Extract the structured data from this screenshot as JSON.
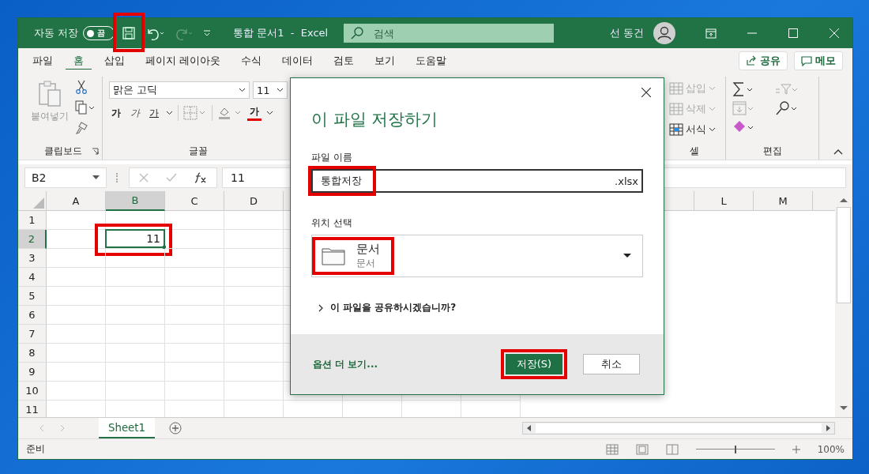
{
  "title_bar": {
    "autosave_label": "자동 저장",
    "autosave_toggle": {
      "label": "끔",
      "on": false
    },
    "save": {
      "annotated": true
    },
    "redo": {
      "disabled": true
    },
    "document_title": "통합 문서1  -  Excel",
    "search_placeholder": "검색",
    "user_name": "선 동건"
  },
  "tabs": [
    {
      "label": "파일",
      "selected": false
    },
    {
      "label": "홈",
      "selected": true
    },
    {
      "label": "삽입",
      "selected": false
    },
    {
      "label": "페이지 레이아웃",
      "selected": false
    },
    {
      "label": "수식",
      "selected": false
    },
    {
      "label": "데이터",
      "selected": false
    },
    {
      "label": "검토",
      "selected": false
    },
    {
      "label": "보기",
      "selected": false
    },
    {
      "label": "도움말",
      "selected": false
    }
  ],
  "share_button": "공유",
  "comment_button": "메모",
  "ribbon": {
    "clipboard": {
      "paste_label": "붙여넣기",
      "group_label": "클립보드"
    },
    "font": {
      "font_name": "맑은 고딕",
      "font_size": "11",
      "bold": "가",
      "italic": "가",
      "underline": "가",
      "font_color": "가",
      "group_label": "글꼴"
    },
    "cells": {
      "items": [
        {
          "label": "삽입",
          "disabled": true
        },
        {
          "label": "삭제",
          "disabled": true
        },
        {
          "label": "서식",
          "disabled": false
        }
      ],
      "group_label": "셀"
    },
    "editing": {
      "group_label": "편집"
    }
  },
  "formula_bar": {
    "name_box": "B2",
    "value": "11"
  },
  "sheet": {
    "columns": [
      {
        "label": "A",
        "selected": false
      },
      {
        "label": "B",
        "selected": true
      },
      {
        "label": "C",
        "selected": false
      },
      {
        "label": "D",
        "selected": false
      },
      {
        "label": "L",
        "selected": false
      },
      {
        "label": "M",
        "selected": false
      }
    ],
    "rows": [
      {
        "label": "1",
        "selected": false
      },
      {
        "label": "2",
        "selected": true,
        "entry": {
          "value": "11",
          "annotated": true
        }
      },
      {
        "label": "3",
        "selected": false
      },
      {
        "label": "4",
        "selected": false
      },
      {
        "label": "5",
        "selected": false
      },
      {
        "label": "6",
        "selected": false
      },
      {
        "label": "7",
        "selected": false
      },
      {
        "label": "8",
        "selected": false
      },
      {
        "label": "9",
        "selected": false
      },
      {
        "label": "10",
        "selected": false
      },
      {
        "label": "11",
        "selected": false
      }
    ]
  },
  "sheet_tabs": [
    {
      "label": "Sheet1",
      "selected": true
    }
  ],
  "status_bar": {
    "status": "준비",
    "zoom_slider": {
      "level": 0.5
    },
    "zoom": "100%"
  },
  "dialog": {
    "title": "이 파일 저장하기",
    "file_name_label": "파일 이름",
    "file_name": {
      "value": "통합저장",
      "annotated": true
    },
    "extension": ".xlsx",
    "location_label": "위치 선택",
    "location": {
      "name": "문서",
      "path": "문서",
      "annotated": true
    },
    "share_prompt": "이 파일을 공유하시겠습니까?",
    "more_options": "옵션 더 보기...",
    "buttons": [
      {
        "label": "저장(S)",
        "kind": "primary",
        "annotated": true
      },
      {
        "label": "취소",
        "kind": "secondary",
        "annotated": false
      }
    ]
  }
}
